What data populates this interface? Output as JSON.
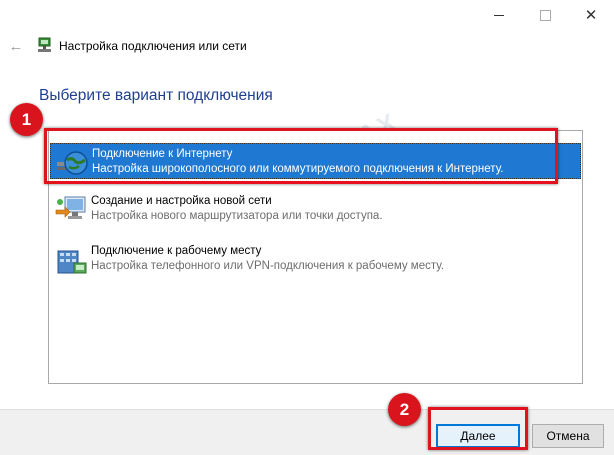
{
  "window": {
    "title": "Настройка подключения или сети",
    "minimize_icon": "minimize-icon",
    "maximize_icon": "maximize-icon",
    "close_icon": "close-icon"
  },
  "heading": "Выберите вариант подключения",
  "options": [
    {
      "title": "Подключение к Интернету",
      "description": "Настройка широкополосного или коммутируемого подключения к Интернету.",
      "icon": "globe-network-icon",
      "selected": true
    },
    {
      "title": "Создание и настройка новой сети",
      "description": "Настройка нового маршрутизатора или точки доступа.",
      "icon": "new-network-icon",
      "selected": false
    },
    {
      "title": "Подключение к рабочему месту",
      "description": "Настройка телефонного или VPN-подключения к рабочему месту.",
      "icon": "workplace-network-icon",
      "selected": false
    }
  ],
  "buttons": {
    "next": "Далее",
    "cancel": "Отмена"
  },
  "annotations": {
    "badge1": "1",
    "badge2": "2"
  },
  "watermark": "ONOUTBUKAX",
  "colors": {
    "selection": "#1f78d1",
    "heading": "#1f3f8f",
    "callout": "#e0141e"
  }
}
